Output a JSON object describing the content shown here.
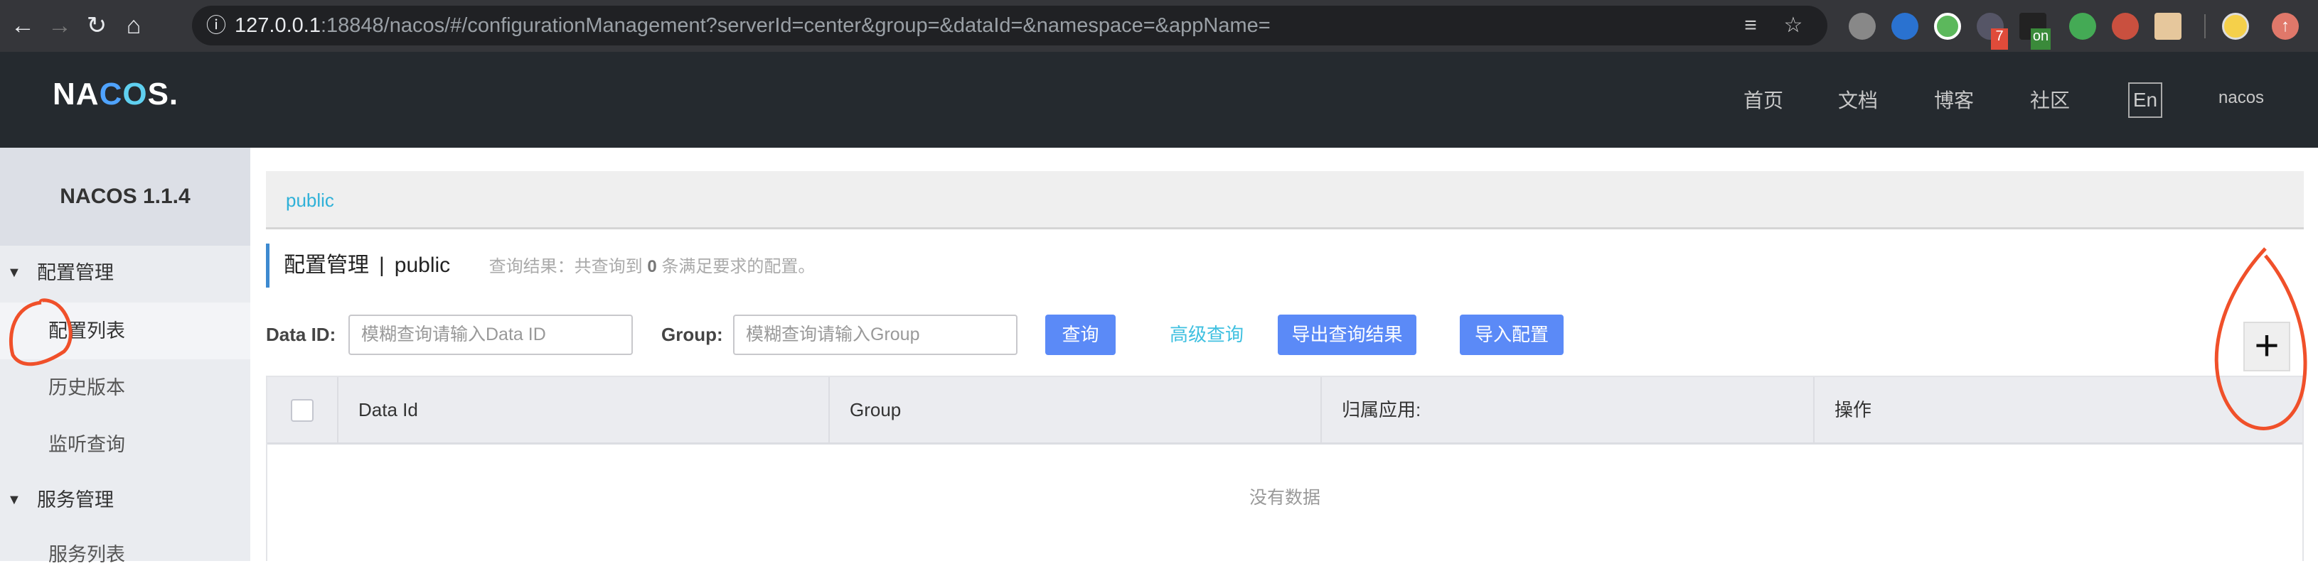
{
  "browser": {
    "url_host": "127.0.0.1",
    "url_rest": ":18848/nacos/#/configurationManagement?serverId=center&group=&dataId=&namespace=&appName=",
    "badge_7": "7",
    "badge_on": "on"
  },
  "header": {
    "logo": "NACOS.",
    "nav": [
      "首页",
      "文档",
      "博客",
      "社区"
    ],
    "lang": "En",
    "user": "nacos"
  },
  "sidebar": {
    "title": "NACOS 1.1.4",
    "groups": [
      {
        "label": "配置管理",
        "items": [
          "配置列表",
          "历史版本",
          "监听查询"
        ]
      },
      {
        "label": "服务管理",
        "items": [
          "服务列表"
        ]
      }
    ]
  },
  "breadcrumb": {
    "namespace": "public"
  },
  "page": {
    "title": "配置管理",
    "separator": "|",
    "namespace": "public",
    "result_prefix": "查询结果：共查询到",
    "result_count": "0",
    "result_suffix": "条满足要求的配置。"
  },
  "search": {
    "dataid_label": "Data ID:",
    "dataid_placeholder": "模糊查询请输入Data ID",
    "group_label": "Group:",
    "group_placeholder": "模糊查询请输入Group",
    "query": "查询",
    "advanced": "高级查询",
    "export": "导出查询结果",
    "import": "导入配置",
    "add": "+"
  },
  "table": {
    "columns": [
      "Data Id",
      "Group",
      "归属应用:",
      "操作"
    ],
    "empty": "没有数据"
  },
  "colors": {
    "accent": "#5b8af7",
    "link": "#2fb1d8",
    "annotation": "#f0502a"
  }
}
